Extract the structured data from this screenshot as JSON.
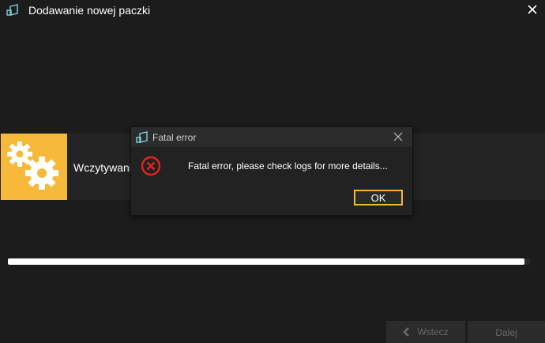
{
  "window": {
    "title": "Dodawanie nowej paczki",
    "app_icon": "app-logo-icon",
    "close_icon": "close-icon"
  },
  "status": {
    "label": "Wczytywanie",
    "icon": "gears-icon",
    "tile_color": "#f6b93a"
  },
  "progress": {
    "value_fraction": 0.99
  },
  "footer": {
    "back_label": "Wstecz",
    "back_icon": "chevron-left-icon",
    "next_label": "Dalej"
  },
  "dialog": {
    "title": "Fatal error",
    "message": "Fatal error, please check logs for more details...",
    "ok_label": "OK",
    "error_icon": "error-x-icon",
    "accent_color": "#f6b93a",
    "error_color": "#e0251e"
  }
}
